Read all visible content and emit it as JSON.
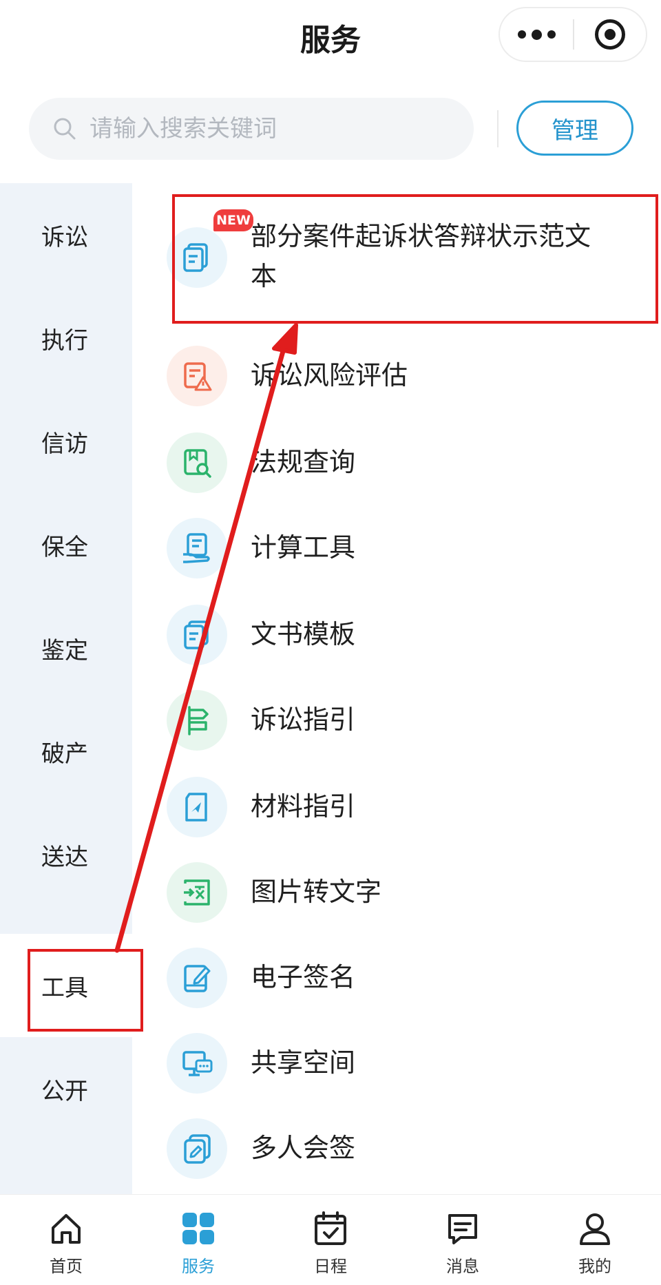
{
  "header": {
    "title": "服务"
  },
  "search": {
    "placeholder": "请输入搜索关键词"
  },
  "manage_label": "管理",
  "sidebar": {
    "items": [
      {
        "label": "诉讼"
      },
      {
        "label": "执行"
      },
      {
        "label": "信访"
      },
      {
        "label": "保全"
      },
      {
        "label": "鉴定"
      },
      {
        "label": "破产"
      },
      {
        "label": "送达"
      },
      {
        "label": "工具",
        "active": true
      },
      {
        "label": "公开"
      }
    ]
  },
  "tools": {
    "badge": "NEW",
    "items": [
      {
        "label_line1": "部分案件起诉状答辩状示范文",
        "label_line2": "本",
        "icon": "document-stack-icon"
      },
      {
        "label": "诉讼风险评估",
        "icon": "risk-warning-icon"
      },
      {
        "label": "法规查询",
        "icon": "law-search-icon"
      },
      {
        "label": "计算工具",
        "icon": "calculator-doc-icon"
      },
      {
        "label": "文书模板",
        "icon": "template-doc-icon"
      },
      {
        "label": "诉讼指引",
        "icon": "signpost-icon"
      },
      {
        "label": "材料指引",
        "icon": "material-guide-icon"
      },
      {
        "label": "图片转文字",
        "icon": "image-to-text-icon"
      },
      {
        "label": "电子签名",
        "icon": "e-signature-icon"
      },
      {
        "label": "共享空间",
        "icon": "shared-space-icon"
      },
      {
        "label": "多人会签",
        "icon": "multi-sign-icon"
      }
    ]
  },
  "tabbar": {
    "items": [
      {
        "label": "首页",
        "icon": "home-icon"
      },
      {
        "label": "服务",
        "icon": "grid-icon",
        "active": true
      },
      {
        "label": "日程",
        "icon": "calendar-icon"
      },
      {
        "label": "消息",
        "icon": "message-icon"
      },
      {
        "label": "我的",
        "icon": "user-icon"
      }
    ]
  },
  "colors": {
    "accent": "#2b9fd6",
    "sidebar_bg": "#eef3f9",
    "annotation_red": "#e01d1d",
    "badge_red": "#ef3d3d"
  }
}
